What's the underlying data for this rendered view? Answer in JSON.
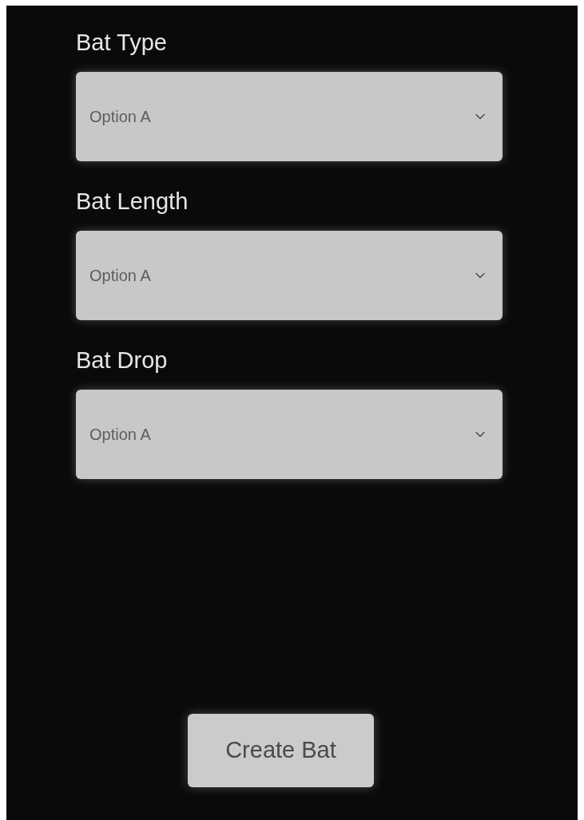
{
  "fields": [
    {
      "label": "Bat Type",
      "value": "Option A"
    },
    {
      "label": "Bat Length",
      "value": "Option A"
    },
    {
      "label": "Bat Drop",
      "value": "Option A"
    }
  ],
  "button": {
    "label": "Create Bat"
  }
}
